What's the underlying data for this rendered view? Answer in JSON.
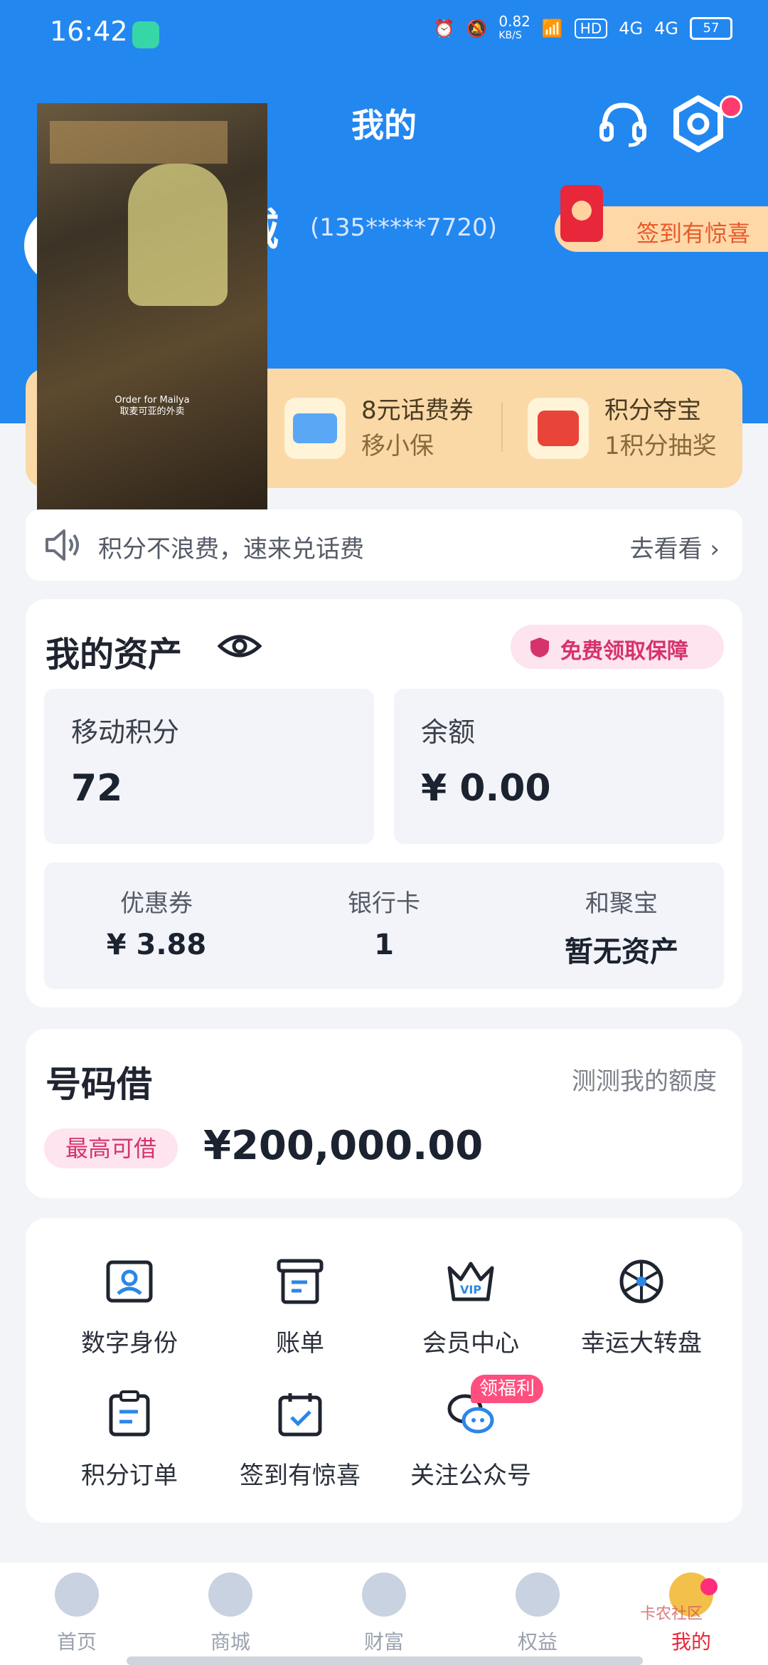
{
  "status": {
    "time": "16:42",
    "speed_value": "0.82",
    "speed_unit": "KB/S",
    "hd": "HD",
    "net1": "4G",
    "net2": "4G",
    "battery": "57"
  },
  "header": {
    "title": "我的"
  },
  "profile": {
    "username": "诚",
    "phone": "(135*****7720)",
    "sign_reward": "签到有惊喜"
  },
  "video": {
    "caption_line1": "Order for Mailya",
    "caption_line2": "取麦可亚的外卖"
  },
  "promos": [
    {
      "title": "8元话费券",
      "subtitle": "移小保"
    },
    {
      "title": "积分夺宝",
      "subtitle": "1积分抽奖"
    }
  ],
  "notice": {
    "text": "积分不浪费，速来兑话费",
    "link": "去看看"
  },
  "assets": {
    "title": "我的资产",
    "badge": "免费领取保障",
    "points_label": "移动积分",
    "points_value": "72",
    "balance_label": "余额",
    "balance_value": "¥ 0.00",
    "coupon_label": "优惠券",
    "coupon_value": "¥ 3.88",
    "bankcard_label": "银行卡",
    "bankcard_value": "1",
    "hjb_label": "和聚宝",
    "hjb_value": "暂无资产"
  },
  "loan": {
    "title": "号码借",
    "link": "测测我的额度",
    "tag": "最高可借",
    "amount": "¥200,000.00"
  },
  "services": [
    {
      "label": "数字身份"
    },
    {
      "label": "账单"
    },
    {
      "label": "会员中心"
    },
    {
      "label": "幸运大转盘"
    },
    {
      "label": "积分订单"
    },
    {
      "label": "签到有惊喜"
    },
    {
      "label": "关注公众号"
    }
  ],
  "services_badge": "领福利",
  "tabs": [
    {
      "label": "首页"
    },
    {
      "label": "商城"
    },
    {
      "label": "财富"
    },
    {
      "label": "权益"
    },
    {
      "label": "我的"
    }
  ],
  "watermark": "卡农社区",
  "colors": {
    "brand_blue": "#2387f0",
    "promo_bg": "#fbd9a7",
    "accent_pink": "#d6336c",
    "tab_active": "#e8273a"
  }
}
